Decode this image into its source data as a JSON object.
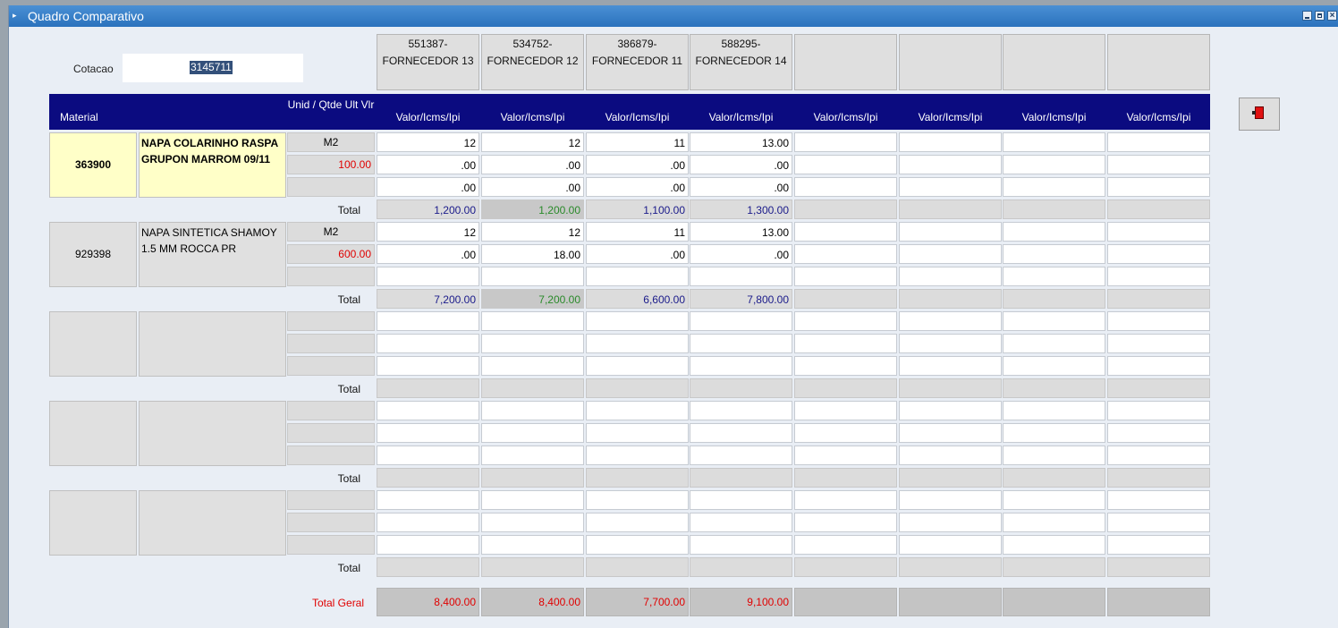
{
  "window": {
    "title": "Quadro Comparativo"
  },
  "cotacao": {
    "label": "Cotacao",
    "value": "3145711"
  },
  "suppliers": [
    {
      "code": "551387-",
      "name": "FORNECEDOR 13"
    },
    {
      "code": "534752-",
      "name": "FORNECEDOR 12"
    },
    {
      "code": "386879-",
      "name": "FORNECEDOR 11"
    },
    {
      "code": "588295-",
      "name": "FORNECEDOR 14"
    },
    {
      "code": "",
      "name": ""
    },
    {
      "code": "",
      "name": ""
    },
    {
      "code": "",
      "name": ""
    },
    {
      "code": "",
      "name": ""
    }
  ],
  "header": {
    "material": "Material",
    "unit_qty": "Unid / Qtde Ult Vlr",
    "supplier_col": "Valor/Icms/Ipi"
  },
  "total_label": "Total",
  "items": [
    {
      "code": "363900",
      "description": "NAPA COLARINHO RASPA GRUPON MARROM 09/11",
      "highlight": true,
      "unit": "M2",
      "last_value": "100.00",
      "valor": [
        "12",
        "12",
        "11",
        "13.00",
        "",
        "",
        "",
        ""
      ],
      "icms": [
        ".00",
        ".00",
        ".00",
        ".00",
        "",
        "",
        "",
        ""
      ],
      "ipi": [
        ".00",
        ".00",
        ".00",
        ".00",
        "",
        "",
        "",
        ""
      ],
      "totals": [
        "1,200.00",
        "1,200.00",
        "1,100.00",
        "1,300.00",
        "",
        "",
        "",
        ""
      ]
    },
    {
      "code": "929398",
      "description": "NAPA SINTETICA SHAMOY 1.5 MM ROCCA PR",
      "highlight": false,
      "unit": "M2",
      "last_value": "600.00",
      "valor": [
        "12",
        "12",
        "11",
        "13.00",
        "",
        "",
        "",
        ""
      ],
      "icms": [
        ".00",
        "18.00",
        ".00",
        ".00",
        "",
        "",
        "",
        ""
      ],
      "ipi": [
        "",
        "",
        "",
        "",
        "",
        "",
        "",
        ""
      ],
      "totals": [
        "7,200.00",
        "7,200.00",
        "6,600.00",
        "7,800.00",
        "",
        "",
        "",
        ""
      ]
    },
    {
      "code": "",
      "description": "",
      "highlight": false,
      "unit": "",
      "last_value": "",
      "valor": [
        "",
        "",
        "",
        "",
        "",
        "",
        "",
        ""
      ],
      "icms": [
        "",
        "",
        "",
        "",
        "",
        "",
        "",
        ""
      ],
      "ipi": [
        "",
        "",
        "",
        "",
        "",
        "",
        "",
        ""
      ],
      "totals": [
        "",
        "",
        "",
        "",
        "",
        "",
        "",
        ""
      ]
    },
    {
      "code": "",
      "description": "",
      "highlight": false,
      "unit": "",
      "last_value": "",
      "valor": [
        "",
        "",
        "",
        "",
        "",
        "",
        "",
        ""
      ],
      "icms": [
        "",
        "",
        "",
        "",
        "",
        "",
        "",
        ""
      ],
      "ipi": [
        "",
        "",
        "",
        "",
        "",
        "",
        "",
        ""
      ],
      "totals": [
        "",
        "",
        "",
        "",
        "",
        "",
        "",
        ""
      ]
    },
    {
      "code": "",
      "description": "",
      "highlight": false,
      "unit": "",
      "last_value": "",
      "valor": [
        "",
        "",
        "",
        "",
        "",
        "",
        "",
        ""
      ],
      "icms": [
        "",
        "",
        "",
        "",
        "",
        "",
        "",
        ""
      ],
      "ipi": [
        "",
        "",
        "",
        "",
        "",
        "",
        "",
        ""
      ],
      "totals": [
        "",
        "",
        "",
        "",
        "",
        "",
        "",
        ""
      ]
    }
  ],
  "best_supplier_index": 1,
  "total_geral": {
    "label": "Total Geral",
    "values": [
      "8,400.00",
      "8,400.00",
      "7,700.00",
      "9,100.00",
      "",
      "",
      "",
      ""
    ]
  },
  "colors": {
    "titlebar": "#2b72bd",
    "header": "#0b0b80",
    "highlight_row": "#ffffc8",
    "red_text": "#e00000",
    "total_text": "#1a1a8a",
    "best_total_text": "#2a8a2a"
  },
  "toolbar": {
    "exit_icon": "exit-door-icon"
  }
}
